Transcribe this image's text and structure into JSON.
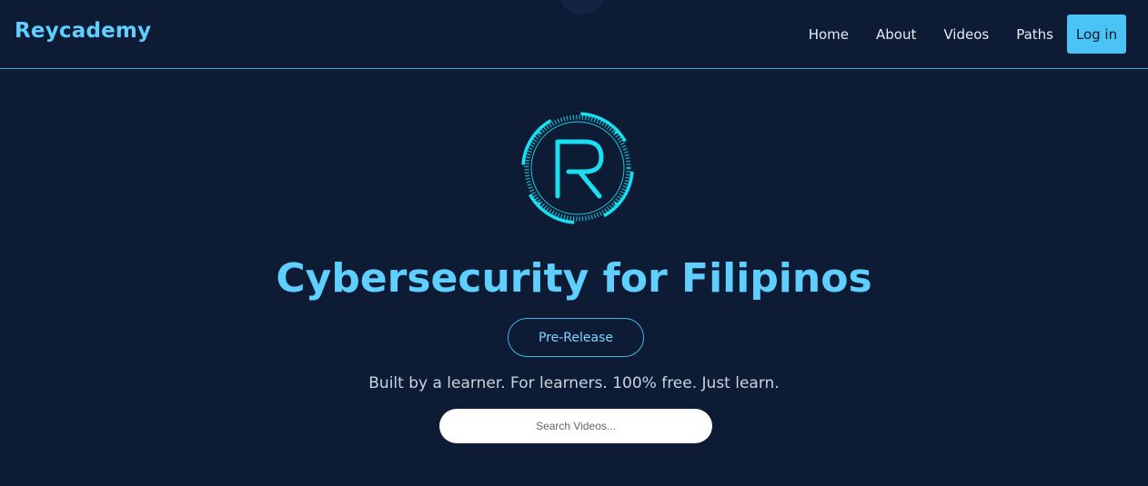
{
  "nav": {
    "brand": "Reycademy",
    "links": [
      "Home",
      "About",
      "Videos",
      "Paths"
    ],
    "login": "Log in"
  },
  "hero": {
    "logo_letter": "R",
    "title": "Cybersecurity for Filipinos",
    "badge": "Pre-Release",
    "tagline": "Built by a learner. For learners. 100% free. Just learn.",
    "search_placeholder": "Search Videos..."
  },
  "colors": {
    "background": "#0e1b35",
    "accent": "#5fcfff",
    "logo_cyan": "#18e0f0"
  }
}
